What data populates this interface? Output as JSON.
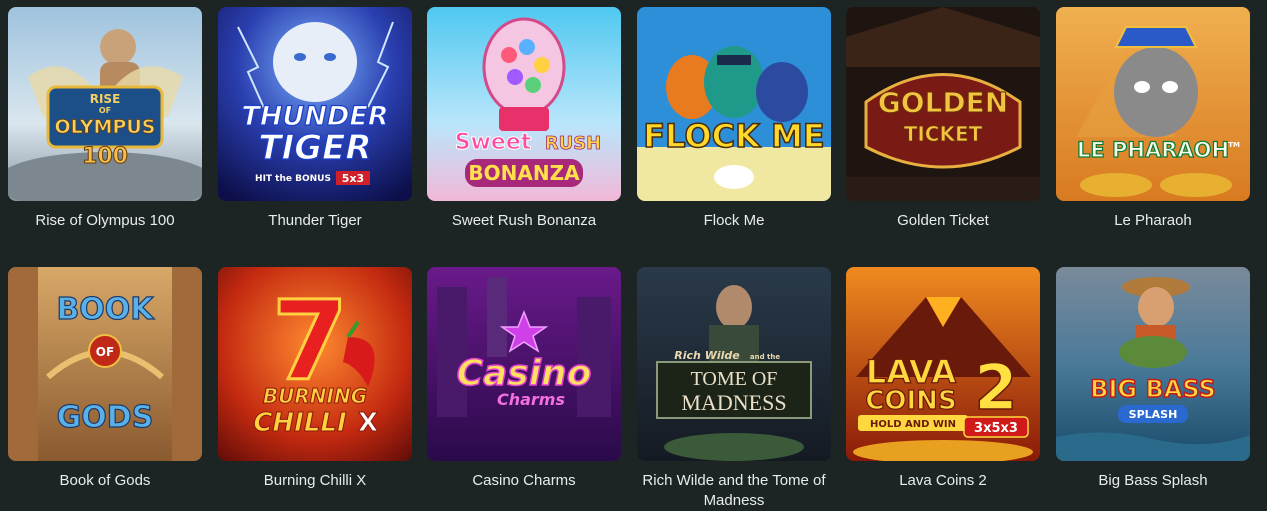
{
  "games": [
    {
      "title": "Rise of Olympus 100",
      "art": [
        "RISE",
        "OF",
        "OLYMPUS",
        "100"
      ]
    },
    {
      "title": "Thunder Tiger",
      "art": [
        "THUNDER",
        "TIGER",
        "HIT the BONUS",
        "5x3"
      ]
    },
    {
      "title": "Sweet Rush Bonanza",
      "art": [
        "Sweet",
        "RUSH",
        "BONANZA"
      ]
    },
    {
      "title": "Flock Me",
      "art": [
        "FLOCK ME"
      ]
    },
    {
      "title": "Golden Ticket",
      "art": [
        "GOLDEN",
        "TICKET"
      ]
    },
    {
      "title": "Le Pharaoh",
      "art": [
        "LE PHARAOH",
        "TM"
      ]
    },
    {
      "title": "Book of Gods",
      "art": [
        "BOOK",
        "OF",
        "GODS"
      ]
    },
    {
      "title": "Burning Chilli X",
      "art": [
        "7",
        "BURNING",
        "CHILLI",
        "X"
      ]
    },
    {
      "title": "Casino Charms",
      "art": [
        "Casino",
        "Charms"
      ]
    },
    {
      "title": "Rich Wilde and the Tome of Madness",
      "art": [
        "Rich Wilde",
        "and the",
        "TOME OF",
        "MADNESS"
      ]
    },
    {
      "title": "Lava Coins 2",
      "art": [
        "LAVA",
        "COINS",
        "2",
        "HOLD AND WIN",
        "3x5x3"
      ]
    },
    {
      "title": "Big Bass Splash",
      "art": [
        "BIG BASS",
        "SPLASH"
      ]
    }
  ],
  "colors": {
    "background": "#1c2424",
    "caption": "#e8ecec"
  }
}
